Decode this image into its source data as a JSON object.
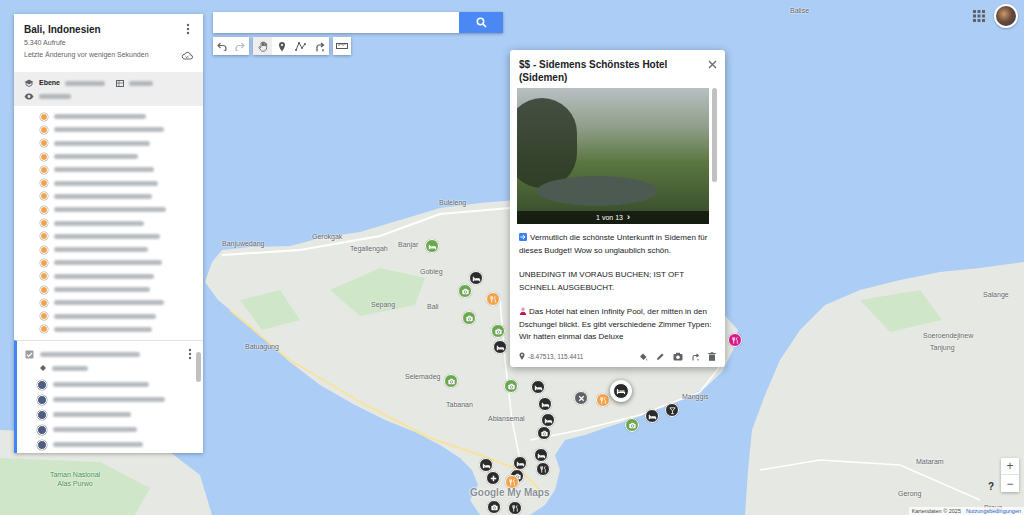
{
  "header": {
    "title": "Bali, Indonesien",
    "views": "5.340 Aufrufe",
    "last_edit": "Letzte Änderung vor wenigen Sekunden"
  },
  "layers": [
    {
      "label": "Ebene",
      "items": [
        {
          "color": "#f2a24a"
        },
        {
          "color": "#f2a24a"
        },
        {
          "color": "#f2a24a"
        },
        {
          "color": "#f2a24a"
        },
        {
          "color": "#f2a24a"
        },
        {
          "color": "#f2a24a"
        },
        {
          "color": "#f2a24a"
        },
        {
          "color": "#f2a24a"
        },
        {
          "color": "#f2a24a"
        },
        {
          "color": "#f2a24a"
        },
        {
          "color": "#f2a24a"
        },
        {
          "color": "#f2a24a"
        },
        {
          "color": "#f2a24a"
        },
        {
          "color": "#f2a24a"
        },
        {
          "color": "#f2a24a"
        },
        {
          "color": "#f2a24a"
        },
        {
          "color": "#f2a24a"
        }
      ]
    },
    {
      "checked": true,
      "items": [
        {
          "color": "#4e5d80"
        },
        {
          "color": "#4e5d80"
        },
        {
          "color": "#4e5d80"
        },
        {
          "color": "#4e5d80"
        },
        {
          "color": "#4e5d80"
        }
      ]
    }
  ],
  "popup": {
    "title": "$$ - Sidemens Schönstes Hotel (Sidemen)",
    "photo_counter": "1 von 13",
    "next": "›",
    "paragraphs": [
      {
        "kind": "arrow",
        "text": "Vermutlich die schönste Unterkunft in Sidemen für dieses Budget! Wow so unglaublich schön."
      },
      {
        "kind": "plain",
        "text": "UNBEDINGT IM VORAUS BUCHEN; IST OFT SCHNELL AUSGEBUCHT."
      },
      {
        "kind": "person",
        "text": "Das Hotel hat einen Infinity Pool, der mitten in den Dschungel blickt. Es gibt verschiedene Zimmer Typen: Wir hatten einmal das Deluxe"
      }
    ],
    "coordinates": "-8.47513, 115.4411"
  },
  "map": {
    "labels": [
      {
        "text": "Balise",
        "kind": "place"
      },
      {
        "text": "Buleleng",
        "kind": "place"
      },
      {
        "text": "Banjuwedang",
        "kind": "place"
      },
      {
        "text": "Gerokgak",
        "kind": "place"
      },
      {
        "text": "Tegallengah",
        "kind": "place"
      },
      {
        "text": "Banjar",
        "kind": "place"
      },
      {
        "text": "Gobleg",
        "kind": "place"
      },
      {
        "text": "Bali",
        "kind": "place"
      },
      {
        "text": "Sepang",
        "kind": "place"
      },
      {
        "text": "Batuagung",
        "kind": "place"
      },
      {
        "text": "Selemadeg",
        "kind": "place"
      },
      {
        "text": "Tabanan",
        "kind": "place"
      },
      {
        "text": "Abiansemal",
        "kind": "place"
      },
      {
        "text": "Manggis",
        "kind": "place"
      },
      {
        "text": "Soeroendejinew",
        "kind": "place"
      },
      {
        "text": "Tanjung",
        "kind": "place"
      },
      {
        "text": "Salange",
        "kind": "place"
      },
      {
        "text": "Mataram",
        "kind": "place"
      },
      {
        "text": "Gerong",
        "kind": "place"
      },
      {
        "text": "Praya",
        "kind": "place"
      },
      {
        "text": "Taman Nasional Alas Purwo",
        "kind": "park"
      }
    ],
    "pins": [
      {
        "color": "#6aa84f",
        "kind": "bed",
        "selected": false
      },
      {
        "color": "#2b2b2b",
        "kind": "bed",
        "selected": false
      },
      {
        "color": "#6aa84f",
        "kind": "camera",
        "selected": false
      },
      {
        "color": "#f2a24a",
        "kind": "food",
        "selected": false
      },
      {
        "color": "#6aa84f",
        "kind": "camera",
        "selected": false
      },
      {
        "color": "#6aa84f",
        "kind": "camera",
        "selected": false
      },
      {
        "color": "#2b2b2b",
        "kind": "bed",
        "selected": false
      },
      {
        "color": "#6aa84f",
        "kind": "camera",
        "selected": false
      },
      {
        "color": "#6aa84f",
        "kind": "camera",
        "selected": false
      },
      {
        "color": "#2b2b2b",
        "kind": "bed",
        "selected": false
      },
      {
        "color": "#5f6368",
        "kind": "cross",
        "selected": false
      },
      {
        "color": "#f2a24a",
        "kind": "food",
        "selected": false
      },
      {
        "color": "#2b2b2b",
        "kind": "bed",
        "selected": true
      },
      {
        "color": "#6aa84f",
        "kind": "camera",
        "selected": false
      },
      {
        "color": "#2b2b2b",
        "kind": "bed",
        "selected": false
      },
      {
        "color": "#2b2b2b",
        "kind": "drink",
        "selected": false
      },
      {
        "color": "#d81b8c",
        "kind": "food",
        "selected": false
      },
      {
        "color": "#2b2b2b",
        "kind": "bed",
        "selected": false
      },
      {
        "color": "#2b2b2b",
        "kind": "bed",
        "selected": false
      },
      {
        "color": "#2b2b2b",
        "kind": "camera",
        "selected": false
      },
      {
        "color": "#2b2b2b",
        "kind": "bed",
        "selected": false
      },
      {
        "color": "#2b2b2b",
        "kind": "food",
        "selected": false
      },
      {
        "color": "#2b2b2b",
        "kind": "bed",
        "selected": false
      },
      {
        "color": "#2b2b2b",
        "kind": "camera",
        "selected": false
      },
      {
        "color": "#2b2b2b",
        "kind": "bed",
        "selected": false
      },
      {
        "color": "#2b2b2b",
        "kind": "plus",
        "selected": false
      },
      {
        "color": "#f2a24a",
        "kind": "food",
        "selected": false
      },
      {
        "color": "#2b2b2b",
        "kind": "camera",
        "selected": false
      },
      {
        "color": "#2b2b2b",
        "kind": "food",
        "selected": false
      }
    ]
  },
  "watermark": "Google My Maps",
  "zoom": {
    "in": "+",
    "out": "−"
  },
  "help": "?",
  "footer": {
    "attribution": "Kartendaten © 2025",
    "terms": "Nutzungsbedingungen"
  }
}
